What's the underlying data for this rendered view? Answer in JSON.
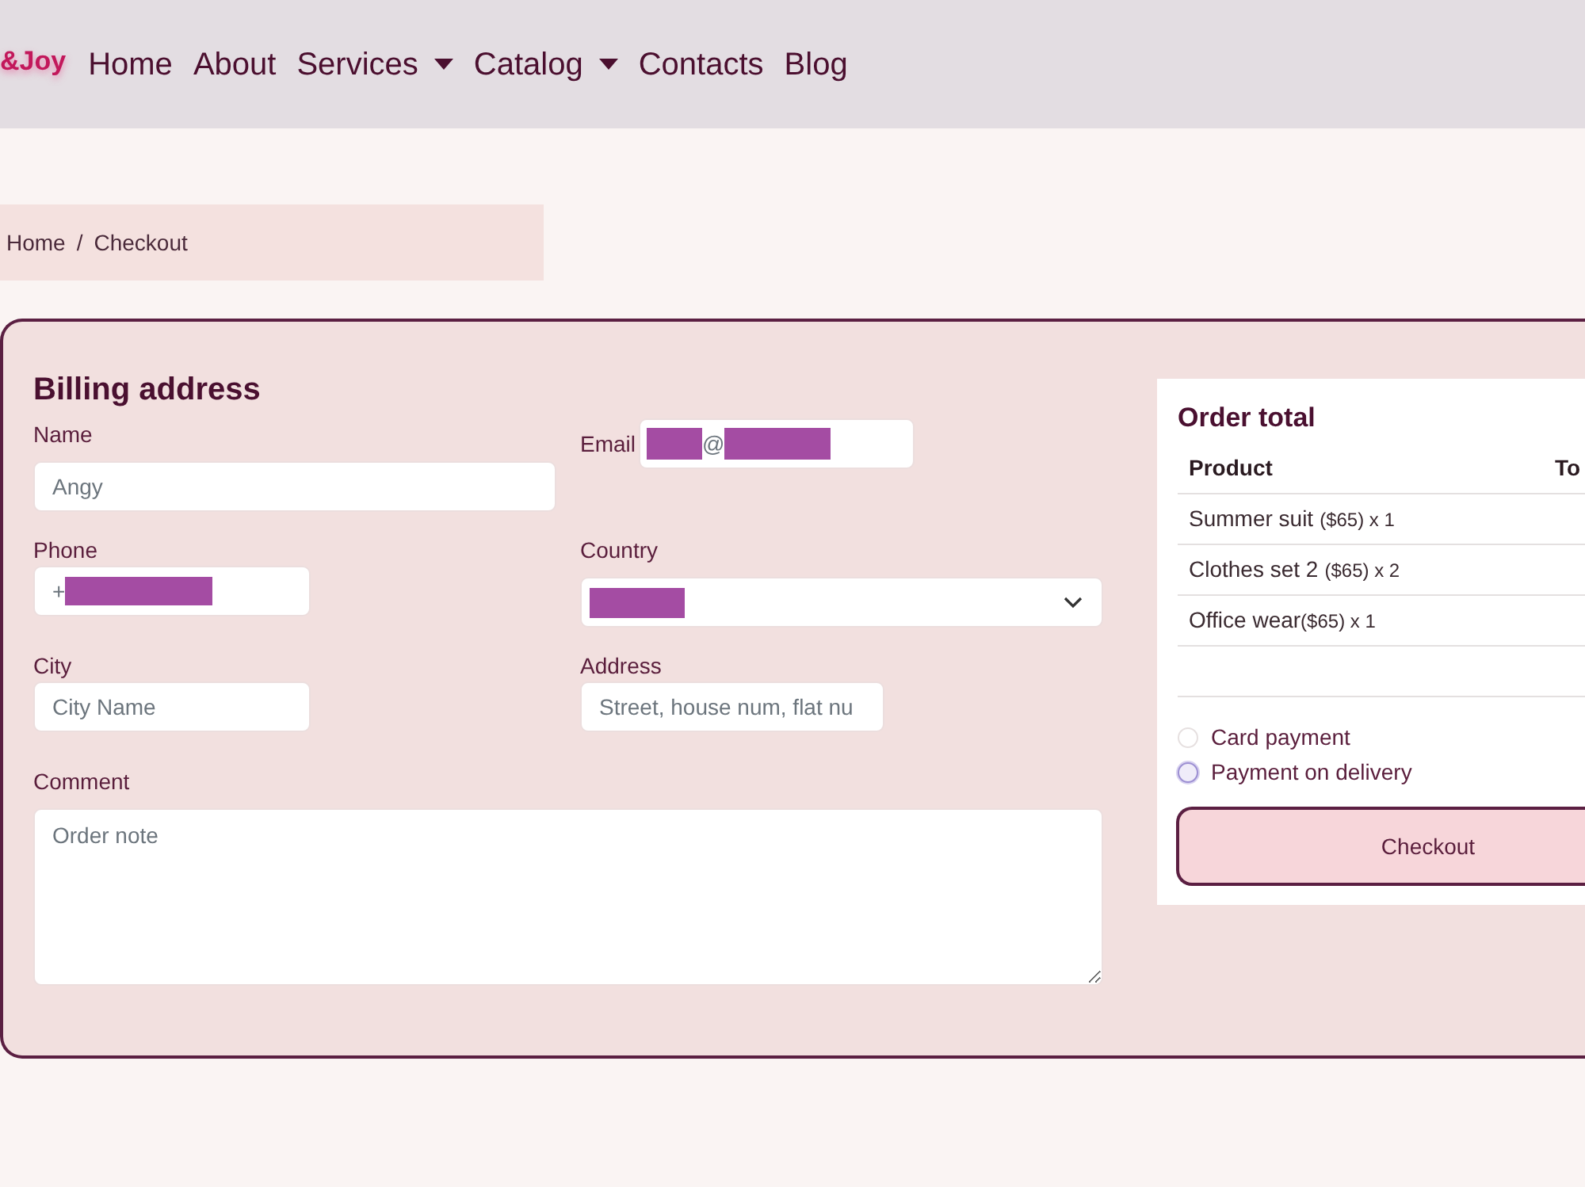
{
  "nav": {
    "brand": "&Joy",
    "items": [
      {
        "label": "Home",
        "dropdown": false
      },
      {
        "label": "About",
        "dropdown": false
      },
      {
        "label": "Services",
        "dropdown": true
      },
      {
        "label": "Catalog",
        "dropdown": true
      },
      {
        "label": "Contacts",
        "dropdown": false
      },
      {
        "label": "Blog",
        "dropdown": false
      }
    ]
  },
  "breadcrumb": {
    "items": [
      "Home",
      "Checkout"
    ],
    "separator": "/"
  },
  "billing": {
    "title": "Billing address",
    "name": {
      "label": "Name",
      "placeholder": "Angy"
    },
    "email": {
      "label": "Email",
      "value": [
        {
          "kind": "redacted"
        },
        {
          "kind": "text",
          "text": "@"
        },
        {
          "kind": "redacted"
        }
      ]
    },
    "phone": {
      "label": "Phone",
      "value": [
        {
          "kind": "text",
          "text": "+"
        },
        {
          "kind": "redacted"
        }
      ]
    },
    "country": {
      "label": "Country",
      "value": [
        {
          "kind": "redacted"
        }
      ]
    },
    "city": {
      "label": "City",
      "placeholder": "City Name"
    },
    "address": {
      "label": "Address",
      "placeholder": "Street, house num, flat nu"
    },
    "comment": {
      "label": "Comment",
      "placeholder": "Order note"
    }
  },
  "order": {
    "title": "Order total",
    "columns": [
      "Product",
      "To"
    ],
    "rows": [
      {
        "name": "Summer suit",
        "price": "($65) x 1",
        "gap": true
      },
      {
        "name": "Clothes set 2",
        "price": "($65) x 2",
        "gap": true
      },
      {
        "name": "Office wear",
        "price": "($65) x 1",
        "gap": false
      }
    ],
    "payment_options": [
      {
        "label": "Card payment",
        "selected": false,
        "focused": false
      },
      {
        "label": "Payment on delivery",
        "selected": false,
        "focused": true
      }
    ],
    "checkout_button": "Checkout"
  }
}
